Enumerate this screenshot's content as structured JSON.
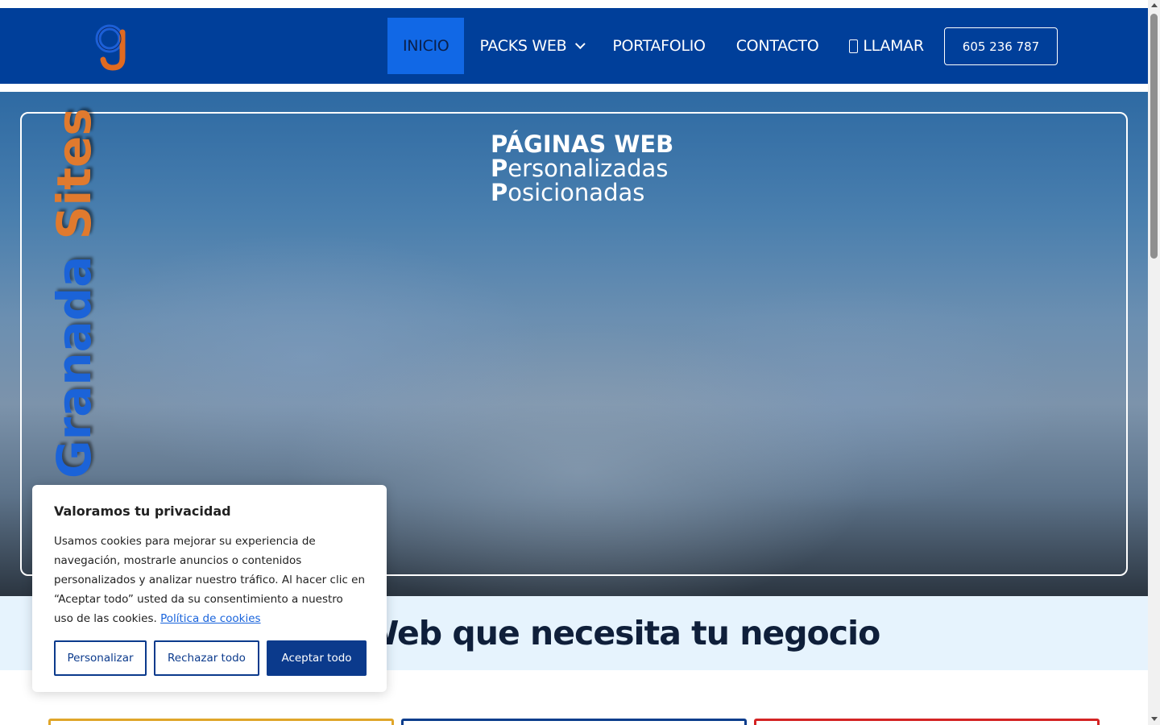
{
  "header": {
    "logo_alt": "gs",
    "nav": [
      {
        "label": "INICIO",
        "active": true
      },
      {
        "label": "PACKS WEB",
        "has_dropdown": true
      },
      {
        "label": "PORTAFOLIO"
      },
      {
        "label": "CONTACTO"
      },
      {
        "label": "LLAMAR",
        "icon": "phone-icon"
      }
    ],
    "phone_button": "605 236 787"
  },
  "hero": {
    "line1": "PÁGINAS WEB",
    "line2_cap": "P",
    "line2_rest": "ersonalizadas",
    "line3_cap": "P",
    "line3_rest": "osicionadas",
    "brand_part1": "Granada",
    "brand_part2": "Sites"
  },
  "pack_section": {
    "heading_bold": "Pack Web",
    "heading_rest": " que necesita tu negocio"
  },
  "cookie_banner": {
    "title": "Valoramos tu privacidad",
    "text": "Usamos cookies para mejorar su experiencia de navegación, mostrarle anuncios o contenidos personalizados y analizar nuestro tráfico. Al hacer clic en “Aceptar todo” usted da su consentimiento a nuestro uso de las cookies.",
    "policy_link": "Política de cookies",
    "btn_customize": "Personalizar",
    "btn_reject": "Rechazar todo",
    "btn_accept": "Aceptar todo"
  },
  "colors": {
    "header_bg": "#003f9a",
    "active_nav": "#1168e6",
    "section_bg": "#e6f3fd",
    "card1_border": "#e0a62a",
    "card2_border": "#0b3d8c",
    "card3_border": "#d42424"
  }
}
